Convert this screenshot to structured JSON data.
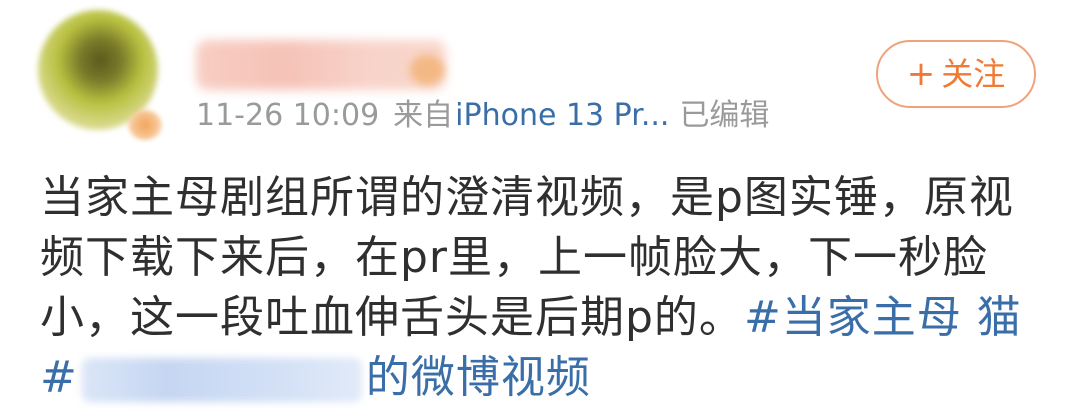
{
  "post": {
    "meta": {
      "timestamp": "11-26 10:09",
      "source_prefix": "来自",
      "device": "iPhone 13 Pr...",
      "edited": "已编辑"
    },
    "follow": {
      "plus": "+",
      "label": "关注"
    },
    "body": {
      "line1": "当家主母剧组所谓的澄清视频，是p图实锤，原视",
      "line2": "频下载下来后，在pr里，上一帧脸大，下一秒脸",
      "line3_text": "小，这一段吐血伸舌头是后期p的。",
      "line3_topic": "#当家主母 猫",
      "line4_hash": "#",
      "line4_suffix": "的微博视频"
    }
  }
}
